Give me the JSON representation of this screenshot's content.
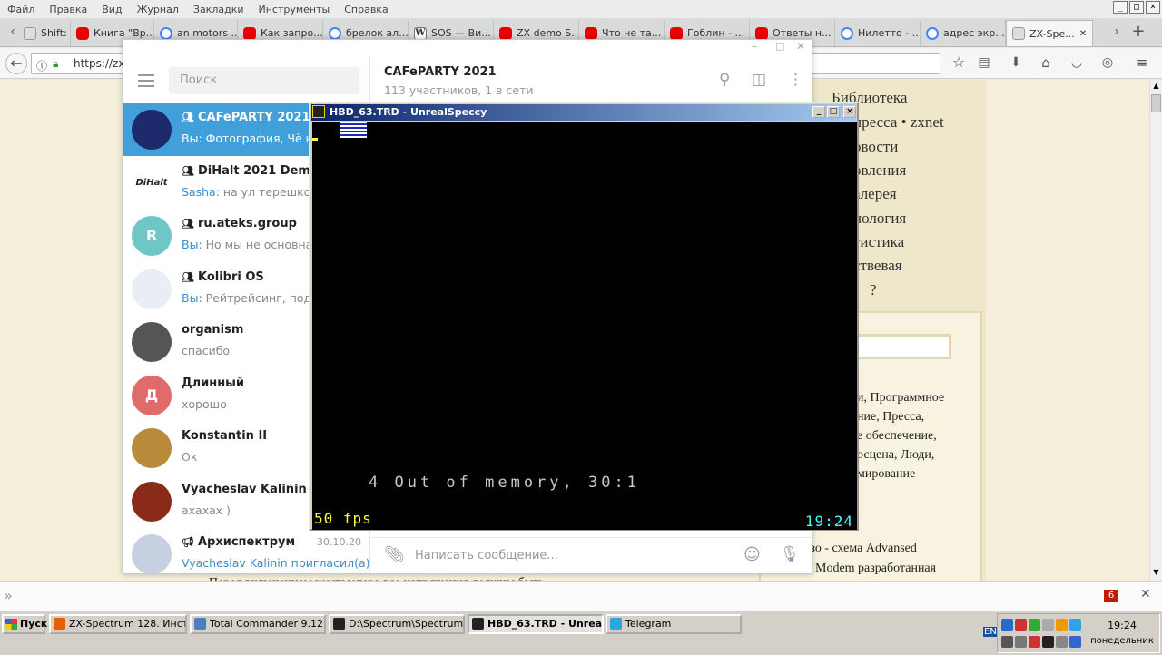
{
  "firefox": {
    "menu": [
      "Файл",
      "Правка",
      "Вид",
      "Журнал",
      "Закладки",
      "Инструменты",
      "Справка"
    ],
    "window_buttons": [
      "_",
      "□",
      "×"
    ],
    "tabs": [
      {
        "label": "Shift: ...",
        "fav": "gray"
      },
      {
        "label": "Книга \"Вр...",
        "fav": "yt"
      },
      {
        "label": "an motors ...",
        "fav": "g"
      },
      {
        "label": "Как запро...",
        "fav": "yt"
      },
      {
        "label": "брелок ал...",
        "fav": "g"
      },
      {
        "label": "SOS — Ви...",
        "fav": "w"
      },
      {
        "label": "ZX demo S...",
        "fav": "yt"
      },
      {
        "label": "Что не та...",
        "fav": "yt"
      },
      {
        "label": "Гоблин - ...",
        "fav": "yt"
      },
      {
        "label": "Ответы н...",
        "fav": "yt"
      },
      {
        "label": "Нилетто - ...",
        "fav": "g"
      },
      {
        "label": "адрес экр...",
        "fav": "g"
      },
      {
        "label": "ZX-Spe...",
        "fav": "gray",
        "active": true
      }
    ],
    "url": "https://zxpr",
    "find_badge": "6"
  },
  "site": {
    "links": [
      "Библиотека",
      "пресса • zxnet",
      "овости",
      "овления",
      "алерея",
      "нология",
      "тистика",
      "ствевая",
      "?"
    ],
    "box_text": [
      "и, Программное",
      "ние, Пресса,",
      "е обеспечение,",
      "осцена, Люди,",
      "мирование"
    ],
    "heading": "тьи:",
    "item1": "езо - схема Advansed",
    "item2": "Modem разработанная",
    "bottom_text": "Перед включением компьютера все напряжения должны быть..."
  },
  "telegram": {
    "search_placeholder": "Поиск",
    "header_title": "CAFePARTY 2021",
    "header_subtitle": "113 участников, 1 в сети",
    "compose_placeholder": "Написать сообщение...",
    "chats": [
      {
        "name": "CAFePARTY 2021",
        "group": true,
        "who": "Вы:",
        "msg": " Фотография, Чё не т",
        "active": true,
        "avatar_color": "#1d2a6b",
        "avatar_text": ""
      },
      {
        "name": "DiHalt 2021 Demop...",
        "group": true,
        "who": "Sasha:",
        "msg": " на ул терешковой",
        "avatar_color": "#ffffff",
        "avatar_text": "DiHalt"
      },
      {
        "name": "ru.ateks.group",
        "group": true,
        "who": "Вы:",
        "msg": " Но мы не основная",
        "avatar_color": "#6fc6c6",
        "avatar_text": "R"
      },
      {
        "name": "Kolibri OS",
        "group": true,
        "who": "Вы:",
        "msg": " Рейтрейсинг, подро",
        "avatar_color": "#e9eef4",
        "avatar_text": ""
      },
      {
        "name": "organism",
        "group": false,
        "who": "",
        "msg": "спасибо",
        "avatar_color": "#555555",
        "avatar_text": ""
      },
      {
        "name": "Длинный",
        "group": false,
        "who": "",
        "msg": "хорошо",
        "avatar_color": "#e16a6a",
        "avatar_text": "Д"
      },
      {
        "name": "Konstantin II",
        "group": false,
        "who": "",
        "msg": "Ок",
        "avatar_color": "#b88a3a",
        "avatar_text": ""
      },
      {
        "name": "Vyacheslav Kalinin",
        "group": false,
        "who": "",
        "msg": "ахахах )",
        "avatar_color": "#8a2a1a",
        "avatar_text": ""
      },
      {
        "name": "Архиспектрум",
        "group": false,
        "channel": true,
        "who": "Vyacheslav Kalinin пригласил(а) ...",
        "msg": "",
        "date": "30.10.20",
        "avatar_color": "#c6d0e0",
        "avatar_text": ""
      }
    ]
  },
  "speccy": {
    "title": "HBD_63.TRD - UnrealSpeccy",
    "message": "4 Out of memory, 30:1",
    "fps": "50 fps",
    "time": "19:24"
  },
  "taskbar": {
    "start": "Пуск",
    "buttons": [
      {
        "label": "ZX-Spectrum 128. Инстр...",
        "color": "#e66000"
      },
      {
        "label": "Total Commander 9.12 - ...",
        "color": "#4b7fc0"
      },
      {
        "label": "D:\\Spectrum\\Spectrum\\U...",
        "color": "#222222"
      },
      {
        "label": "HBD_63.TRD - Unreal...",
        "color": "#222222",
        "pressed": true
      },
      {
        "label": "Telegram",
        "color": "#2ca5e0"
      }
    ],
    "lang": "EN",
    "clock": "19:24",
    "day": "понедельник"
  }
}
